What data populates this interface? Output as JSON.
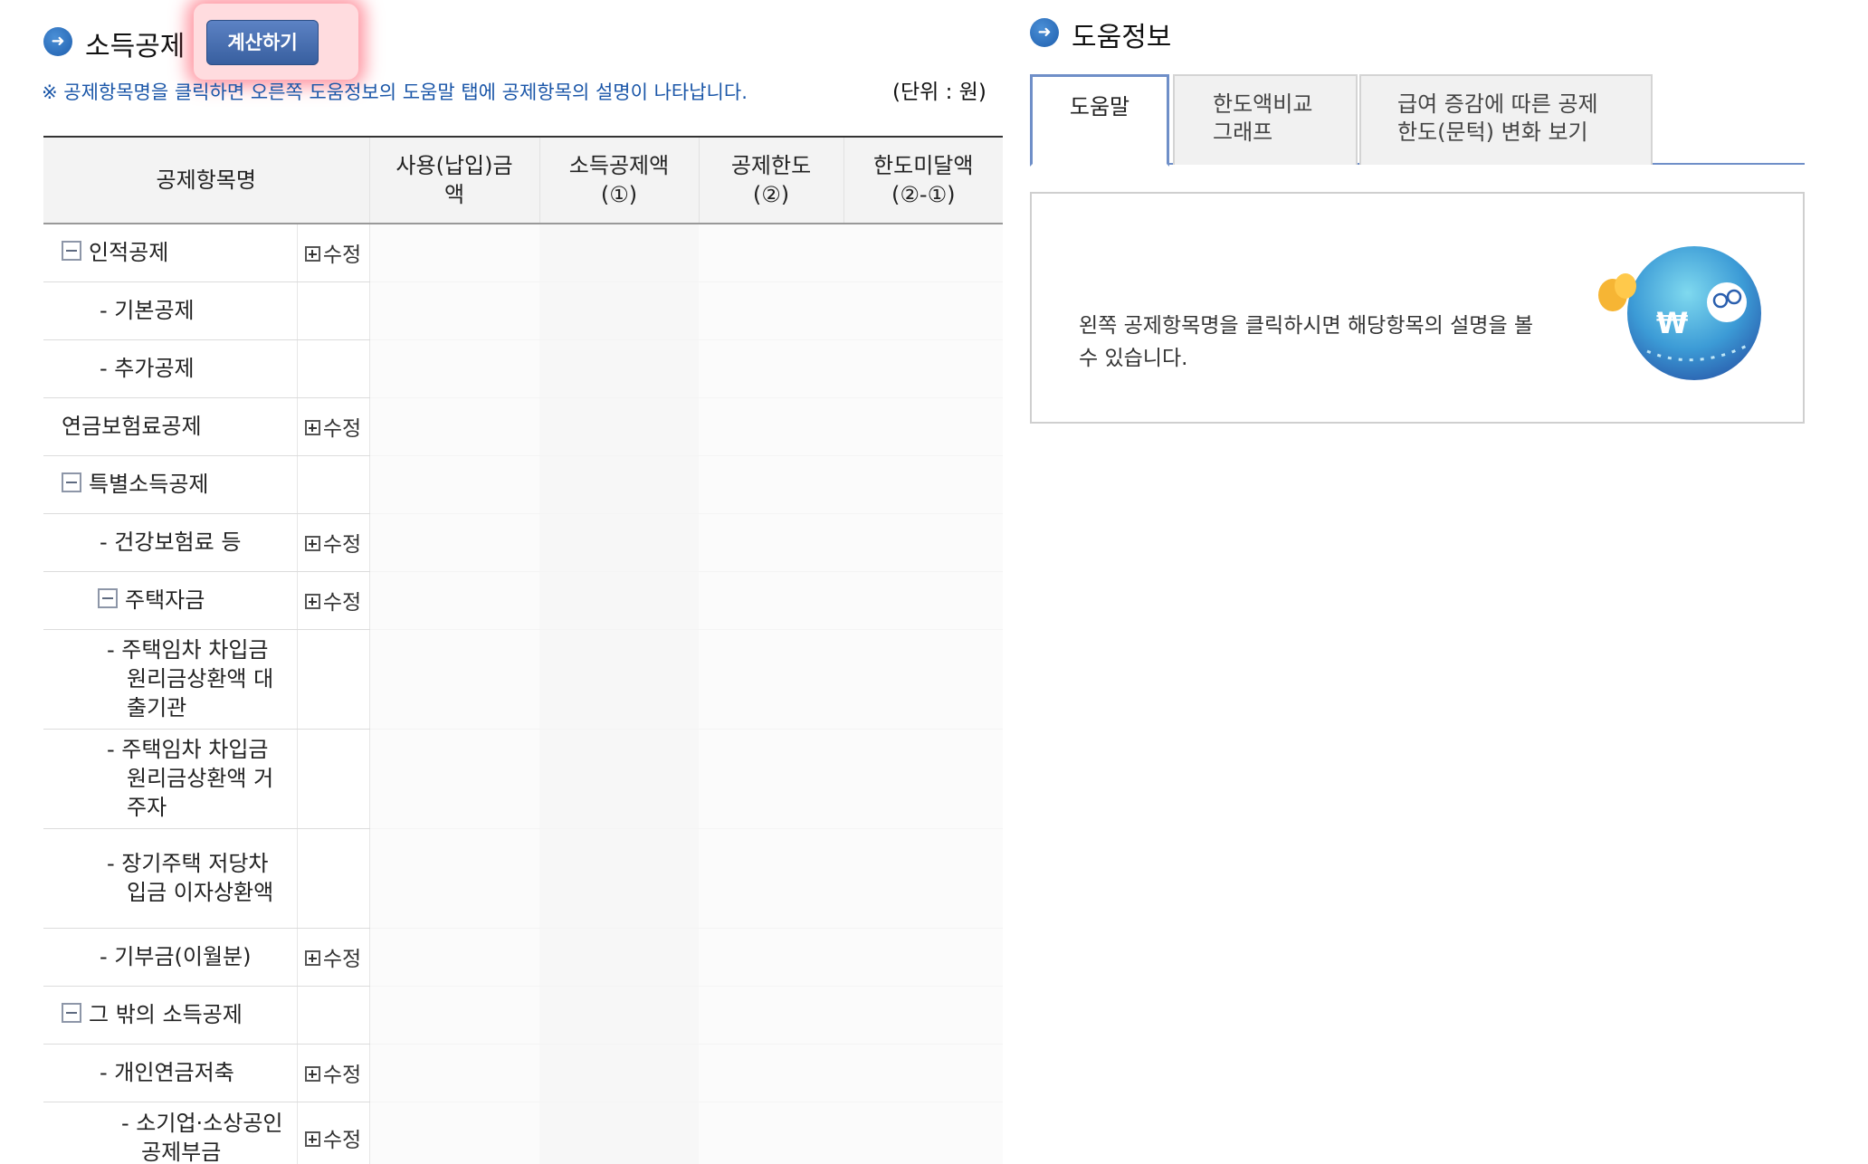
{
  "left_panel": {
    "title": "소득공제",
    "calc_button": "계산하기",
    "notice": "※ 공제항목명을 클릭하면 오른쪽 도움정보의 도움말 탭에 공제항목의 설명이 나타납니다.",
    "unit": "(단위 : 원)"
  },
  "table": {
    "headers": {
      "name": "공제항목명",
      "paid": "사용(납입)금액",
      "deduction": "소득공제액(①)",
      "limit": "공제한도(②)",
      "shortfall": "한도미달액(②-①)"
    },
    "edit_label": "수정",
    "rows": [
      {
        "label": "인적공제",
        "has_edit": true
      },
      {
        "label": "- 기본공제",
        "has_edit": false
      },
      {
        "label": "- 추가공제",
        "has_edit": false
      },
      {
        "label": "연금보험료공제",
        "has_edit": true
      },
      {
        "label": "특별소득공제",
        "has_edit": false
      },
      {
        "label": "- 건강보험료 등",
        "has_edit": true
      },
      {
        "label": "주택자금",
        "has_edit": true
      },
      {
        "label": "- 주택임차 차입금 원리금상환액 대출기관",
        "has_edit": false
      },
      {
        "label": "- 주택임차 차입금 원리금상환액 거주자",
        "has_edit": false
      },
      {
        "label": "- 장기주택 저당차입금 이자상환액",
        "has_edit": false
      },
      {
        "label": "- 기부금(이월분)",
        "has_edit": true
      },
      {
        "label": "그 밖의 소득공제",
        "has_edit": false
      },
      {
        "label": "- 개인연금저축",
        "has_edit": true
      },
      {
        "label": "- 소기업·소상공인 공제부금",
        "has_edit": true
      }
    ]
  },
  "right_panel": {
    "title": "도움정보",
    "tabs": [
      {
        "label": "도움말",
        "active": true
      },
      {
        "label": "한도액비교 그래프",
        "active": false
      },
      {
        "label": "급여 증감에 따른 공제 한도(문턱) 변화 보기",
        "active": false
      }
    ],
    "help_text": "왼쪽 공제항목명을 클릭하시면 해당항목의 설명을 볼 수 있습니다.",
    "mascot_symbol": "₩"
  },
  "icons": {
    "section_bullet": "arrow-circle-icon",
    "collapse": "minus-box-icon",
    "expand": "plus-box-icon"
  },
  "colors": {
    "button": "#4a70b0",
    "link_text": "#1a56a8",
    "tab_border": "#6f8fc8",
    "highlight": "#ff4a5e"
  }
}
